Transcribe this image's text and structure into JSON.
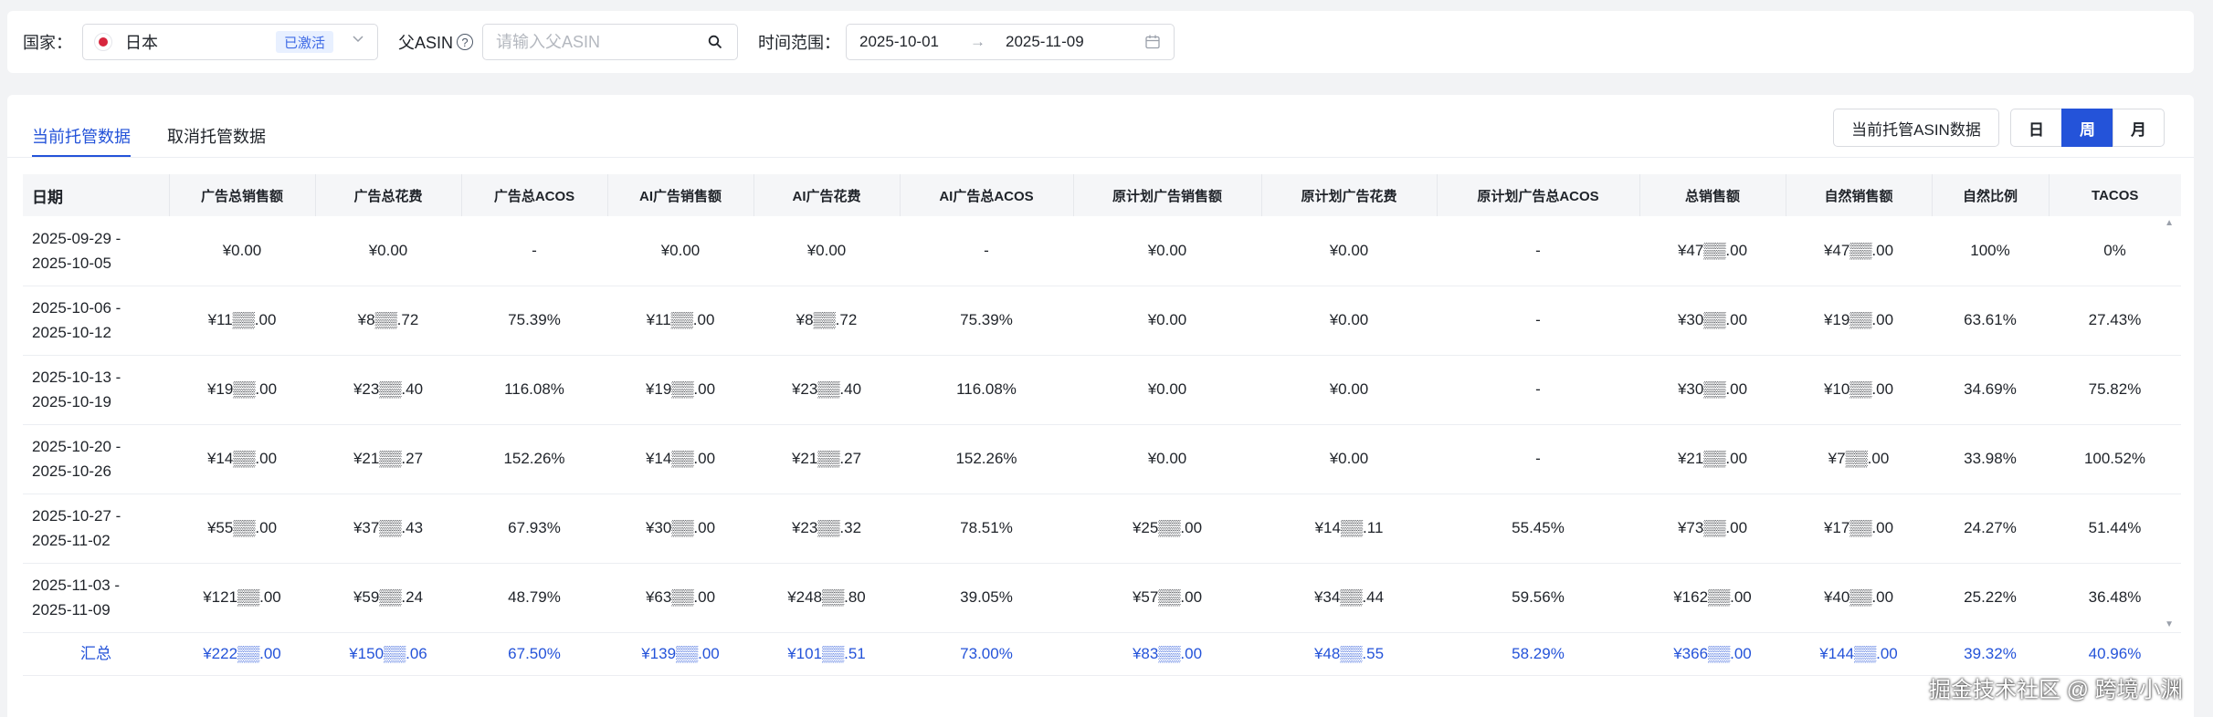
{
  "filters": {
    "country_label": "国家：",
    "country_value": "日本",
    "country_flag": "japan-flag-icon",
    "country_badge": "已激活",
    "parent_asin_label": "父ASIN",
    "parent_asin_placeholder": "请输入父ASIN",
    "time_range_label": "时间范围：",
    "date_start": "2025-10-01",
    "date_end": "2025-11-09"
  },
  "tabs": [
    {
      "label": "当前托管数据",
      "active": true
    },
    {
      "label": "取消托管数据",
      "active": false
    }
  ],
  "toolbar": {
    "asin_data_button": "当前托管ASIN数据",
    "period_options": [
      "日",
      "周",
      "月"
    ],
    "period_selected": "周"
  },
  "table": {
    "columns": [
      "日期",
      "广告总销售额",
      "广告总花费",
      "广告总ACOS",
      "AI广告销售额",
      "AI广告花费",
      "AI广告总ACOS",
      "原计划广告销售额",
      "原计划广告花费",
      "原计划广告总ACOS",
      "总销售额",
      "自然销售额",
      "自然比例",
      "TACOS"
    ],
    "rows": [
      {
        "date_start": "2025-09-29 -",
        "date_end": "2025-10-05",
        "cells": [
          "¥0.00",
          "¥0.00",
          "-",
          "¥0.00",
          "¥0.00",
          "-",
          "¥0.00",
          "¥0.00",
          "-",
          "¥47▒▒.00",
          "¥47▒▒.00",
          "100%",
          "0%"
        ]
      },
      {
        "date_start": "2025-10-06 -",
        "date_end": "2025-10-12",
        "cells": [
          "¥11▒▒.00",
          "¥8▒▒.72",
          "75.39%",
          "¥11▒▒.00",
          "¥8▒▒.72",
          "75.39%",
          "¥0.00",
          "¥0.00",
          "-",
          "¥30▒▒.00",
          "¥19▒▒.00",
          "63.61%",
          "27.43%"
        ]
      },
      {
        "date_start": "2025-10-13 -",
        "date_end": "2025-10-19",
        "cells": [
          "¥19▒▒.00",
          "¥23▒▒.40",
          "116.08%",
          "¥19▒▒.00",
          "¥23▒▒.40",
          "116.08%",
          "¥0.00",
          "¥0.00",
          "-",
          "¥30▒▒.00",
          "¥10▒▒.00",
          "34.69%",
          "75.82%"
        ]
      },
      {
        "date_start": "2025-10-20 -",
        "date_end": "2025-10-26",
        "cells": [
          "¥14▒▒.00",
          "¥21▒▒.27",
          "152.26%",
          "¥14▒▒.00",
          "¥21▒▒.27",
          "152.26%",
          "¥0.00",
          "¥0.00",
          "-",
          "¥21▒▒.00",
          "¥7▒▒.00",
          "33.98%",
          "100.52%"
        ]
      },
      {
        "date_start": "2025-10-27 -",
        "date_end": "2025-11-02",
        "cells": [
          "¥55▒▒.00",
          "¥37▒▒.43",
          "67.93%",
          "¥30▒▒.00",
          "¥23▒▒.32",
          "78.51%",
          "¥25▒▒.00",
          "¥14▒▒.11",
          "55.45%",
          "¥73▒▒.00",
          "¥17▒▒.00",
          "24.27%",
          "51.44%"
        ]
      },
      {
        "date_start": "2025-11-03 -",
        "date_end": "2025-11-09",
        "cells": [
          "¥121▒▒.00",
          "¥59▒▒.24",
          "48.79%",
          "¥63▒▒.00",
          "¥248▒▒.80",
          "39.05%",
          "¥57▒▒.00",
          "¥34▒▒.44",
          "59.56%",
          "¥162▒▒.00",
          "¥40▒▒.00",
          "25.22%",
          "36.48%"
        ]
      }
    ],
    "total": {
      "label": "汇总",
      "cells": [
        "¥222▒▒.00",
        "¥150▒▒.06",
        "67.50%",
        "¥139▒▒.00",
        "¥101▒▒.51",
        "73.00%",
        "¥83▒▒.00",
        "¥48▒▒.55",
        "58.29%",
        "¥366▒▒.00",
        "¥144▒▒.00",
        "39.32%",
        "40.96%"
      ]
    }
  },
  "watermark": "掘金技术社区 @ 跨境小渊",
  "colors": {
    "accent": "#2453d9",
    "badge_bg": "#e8f0ff",
    "flag_red": "#d7263d"
  }
}
